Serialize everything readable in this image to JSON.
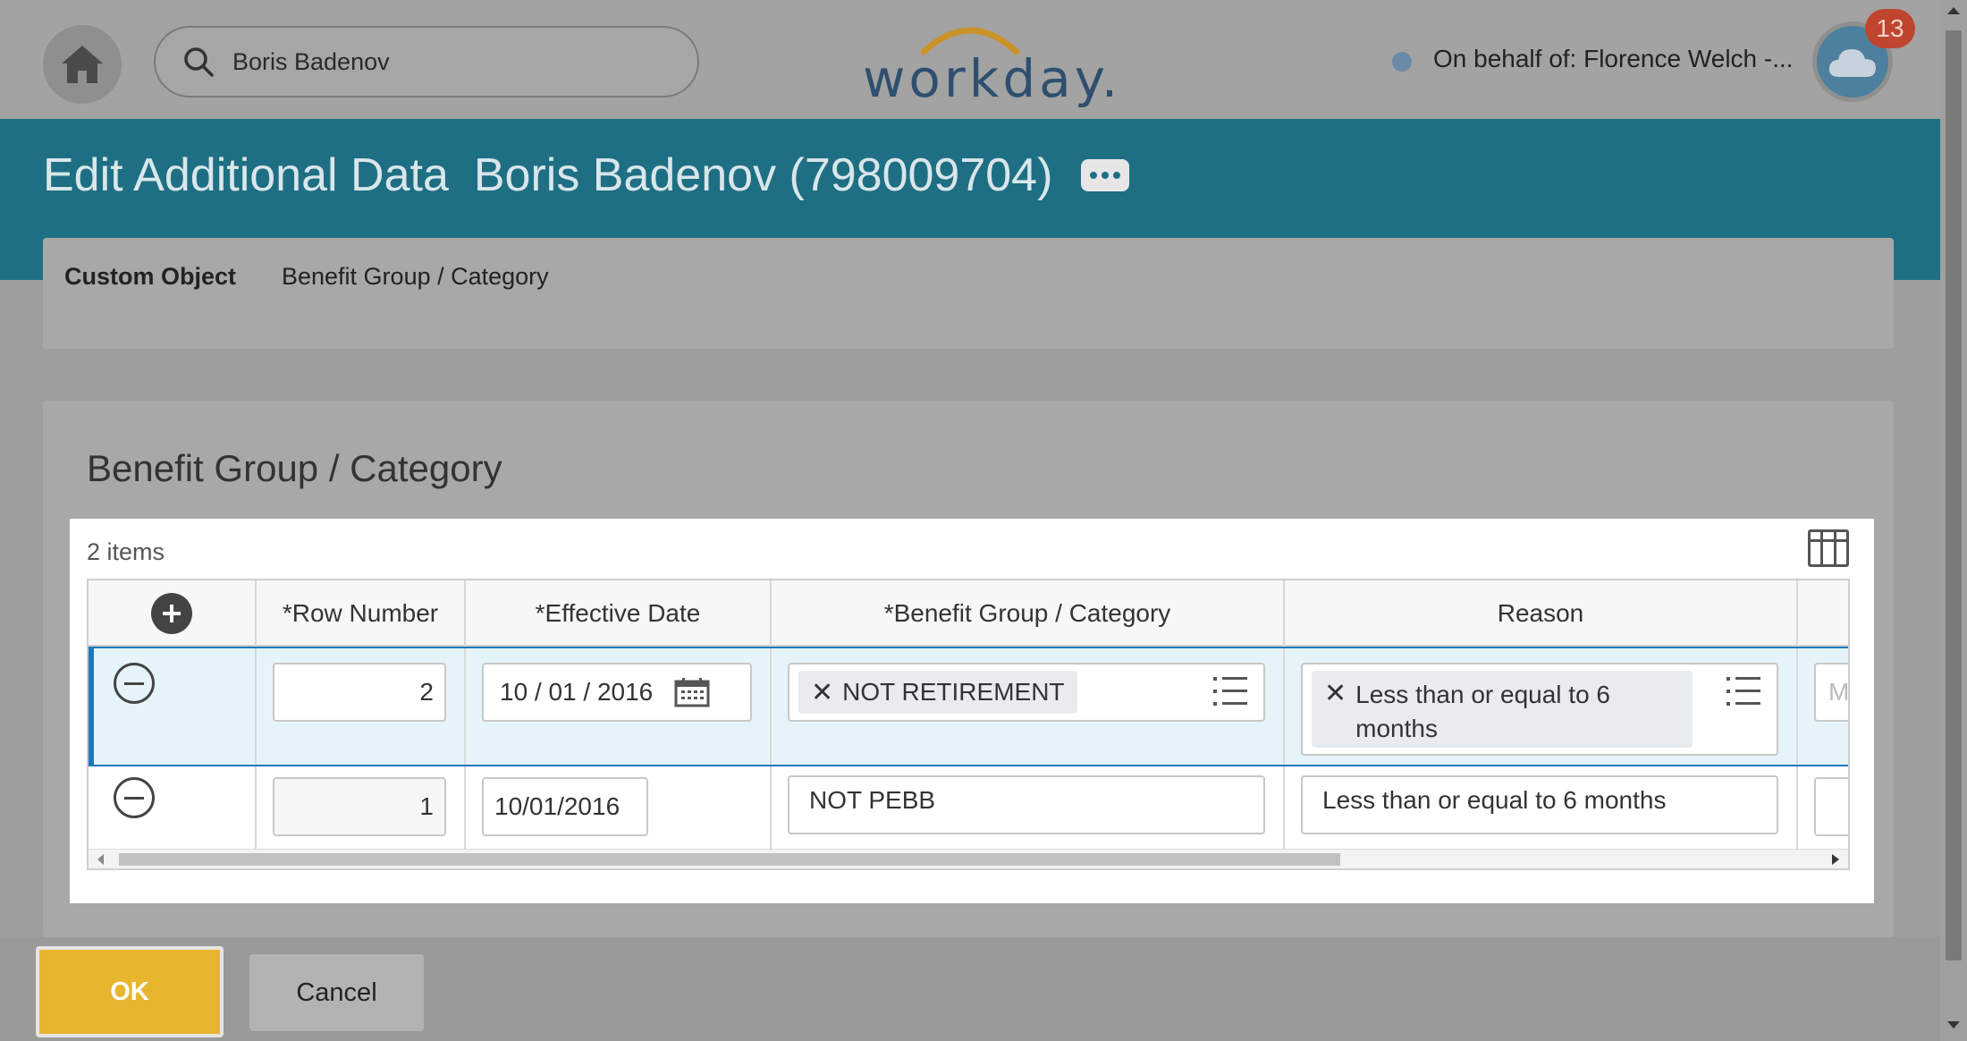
{
  "topbar": {
    "search_value": "Boris Badenov",
    "logo_text": "workday.",
    "behalf_text": "On behalf of: Florence Welch -...",
    "notification_count": "13"
  },
  "header": {
    "title": "Edit Additional Data",
    "subject": "Boris Badenov (798009704)"
  },
  "custom_object": {
    "label": "Custom Object",
    "value": "Benefit Group / Category"
  },
  "section": {
    "title": "Benefit Group / Category",
    "item_count": "2 items"
  },
  "table": {
    "columns": [
      "*Row Number",
      "*Effective Date",
      "*Benefit Group / Category",
      "Reason"
    ],
    "rows": [
      {
        "row_number": "2",
        "effective_date": "10 / 01 / 2016",
        "benefit_group": "NOT RETIREMENT",
        "reason_line1": "Less than or equal to 6",
        "reason_line2": "months",
        "next_col_placeholder": "M"
      },
      {
        "row_number": "1",
        "effective_date": "10/01/2016",
        "benefit_group": "NOT PEBB",
        "reason": "Less than or equal to 6 months"
      }
    ]
  },
  "footer": {
    "ok_label": "OK",
    "cancel_label": "Cancel"
  },
  "colors": {
    "accent": "#1f6f84",
    "ok_button": "#e8b52f",
    "selected_row": "#e5f4fb",
    "notification": "#c0452e"
  }
}
